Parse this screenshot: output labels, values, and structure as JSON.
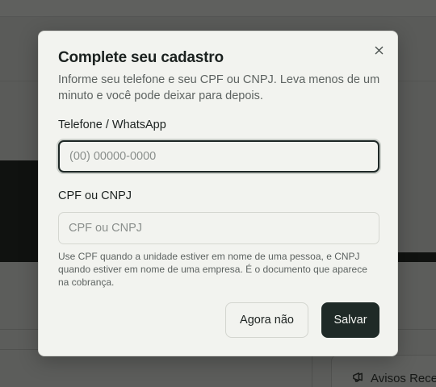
{
  "background": {
    "avisos_label": "Avisos Recentes"
  },
  "modal": {
    "title": "Complete seu cadastro",
    "description": "Informe seu telefone e seu CPF ou CNPJ. Leva menos de um minuto e você pode deixar para depois.",
    "close_icon": "close-icon",
    "phone": {
      "label": "Telefone / WhatsApp",
      "placeholder": "(00) 00000-0000",
      "value": ""
    },
    "cpf": {
      "label": "CPF ou CNPJ",
      "placeholder": "CPF ou CNPJ",
      "value": ""
    },
    "hint": "Use CPF quando a unidade estiver em nome de uma pessoa, e CNPJ quando estiver em nome de uma empresa. É o documento que aparece na cobrança.",
    "secondary_button": "Agora não",
    "primary_button": "Salvar"
  },
  "colors": {
    "primary": "#1f2a27",
    "modal_bg": "#f2f3ef",
    "overlay": "#5a5b59"
  }
}
